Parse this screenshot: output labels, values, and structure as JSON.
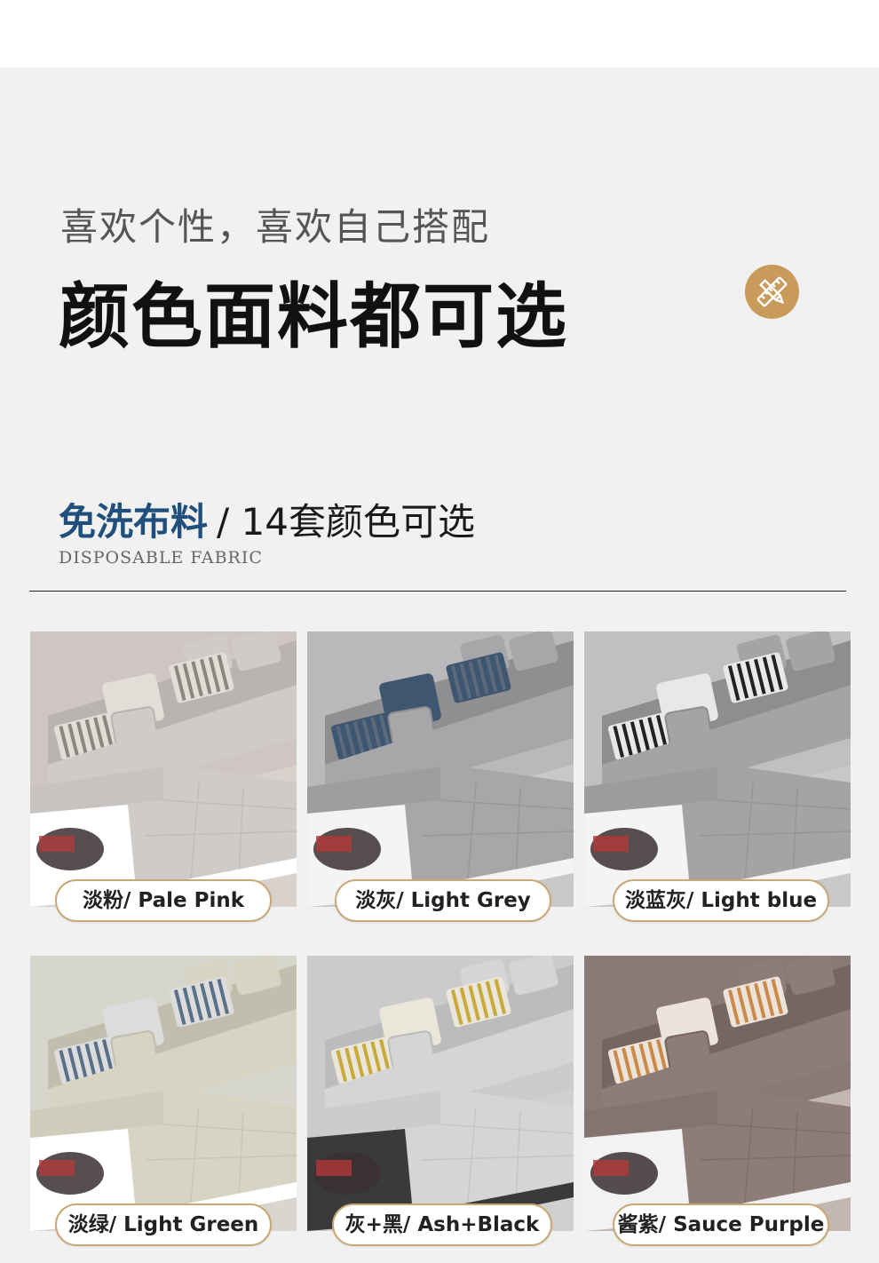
{
  "header": {
    "subtitle": "喜欢个性，喜欢自己搭配",
    "title": "颜色面料都可选",
    "badge_icon": "ruler-pencil-icon"
  },
  "section": {
    "title_highlight": "免洗布料",
    "title_rest": "/ 14套颜色可选",
    "subtitle_en": "DISPOSABLE FABRIC"
  },
  "swatches": [
    {
      "label": "淡粉/ Pale Pink",
      "wall": "#cfc6c3",
      "floor": "#d9d1cc",
      "sofa": "#cfcbc8",
      "sofa_dark": "#b9b4b1",
      "pillow": "#e2ded7",
      "stripe": "#8d8680",
      "base": "#ffffff"
    },
    {
      "label": "淡灰/ Light Grey",
      "wall": "#b9b8ba",
      "floor": "#c9c8c9",
      "sofa": "#a7a7a9",
      "sofa_dark": "#8f8f91",
      "pillow": "#3f5670",
      "stripe": "#5b6a7c",
      "base": "#f4f4f4"
    },
    {
      "label": "淡蓝灰/ Light blue",
      "wall": "#c0c0c1",
      "floor": "#c7c9c8",
      "sofa": "#a3a4a6",
      "sofa_dark": "#8d8e90",
      "pillow": "#e8e8e8",
      "stripe": "#222222",
      "base": "#f4f4f4"
    },
    {
      "label": "淡绿/ Light Green",
      "wall": "#d6d6cd",
      "floor": "#d8d6cf",
      "sofa": "#d7d4c4",
      "sofa_dark": "#c1bead",
      "pillow": "#dcdcdc",
      "stripe": "#5a7089",
      "base": "#ffffff"
    },
    {
      "label": "灰+黑/ Ash+Black",
      "wall": "#cbcbcc",
      "floor": "#d1d0cf",
      "sofa": "#d5d5d6",
      "sofa_dark": "#bcbcbd",
      "pillow": "#eae6da",
      "stripe": "#c9a93a",
      "base": "#3a3a3c"
    },
    {
      "label": "酱紫/ Sauce Purple",
      "wall": "#8a7a76",
      "floor": "#c2b7b1",
      "sofa": "#8d7c77",
      "sofa_dark": "#766661",
      "pillow": "#ece4da",
      "stripe": "#c98a4a",
      "base": "#f2f2f2"
    }
  ]
}
